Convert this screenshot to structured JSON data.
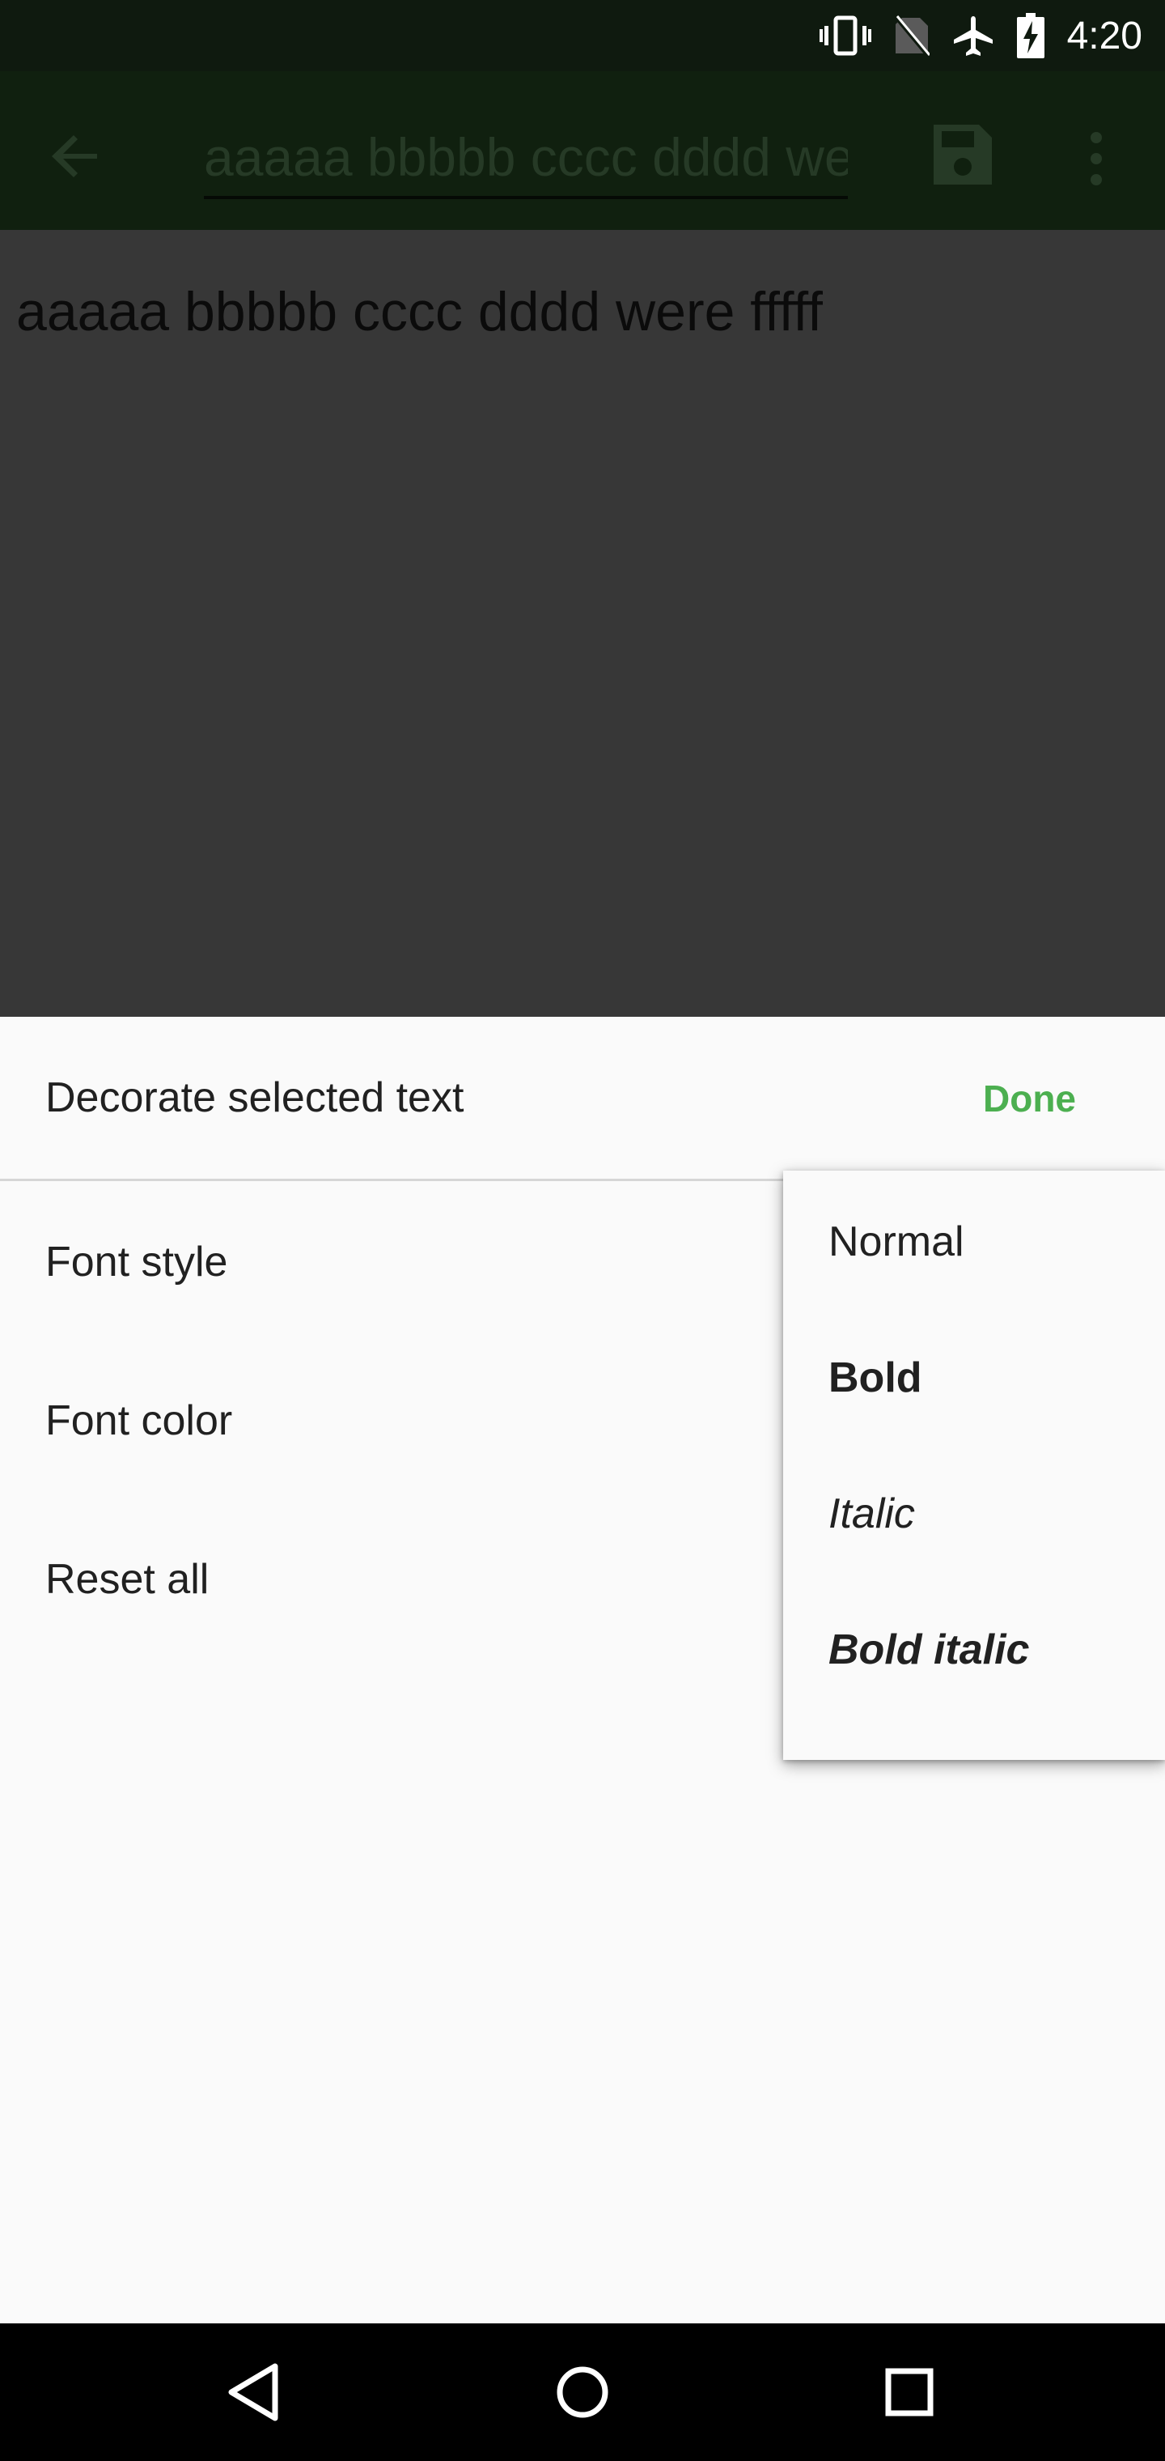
{
  "status_bar": {
    "time": "4:20",
    "icons": [
      "vibrate-icon",
      "no-sim-icon",
      "airplane-icon",
      "battery-charging-icon"
    ]
  },
  "app_bar": {
    "back_icon": "arrow-back-icon",
    "title_value": "aaaaa bbbbb cccc dddd were fffff",
    "save_icon": "save-icon",
    "more_icon": "more-vert-icon"
  },
  "editor": {
    "text": "aaaaa bbbbb cccc dddd were fffff"
  },
  "sheet": {
    "title": "Decorate selected text",
    "done_label": "Done",
    "options": [
      {
        "label": "Font style"
      },
      {
        "label": "Font color"
      },
      {
        "label": "Reset all"
      }
    ]
  },
  "font_style_menu": {
    "items": [
      {
        "label": "Normal"
      },
      {
        "label": "Bold"
      },
      {
        "label": "Italic"
      },
      {
        "label": "Bold italic"
      }
    ]
  },
  "nav_bar": {
    "icons": [
      "back-triangle-icon",
      "home-circle-icon",
      "recents-square-icon"
    ]
  },
  "colors": {
    "accent": "#4caf50",
    "app_bar": "#10200f",
    "sheet_bg": "#fafafa",
    "scrim": "#373737"
  }
}
